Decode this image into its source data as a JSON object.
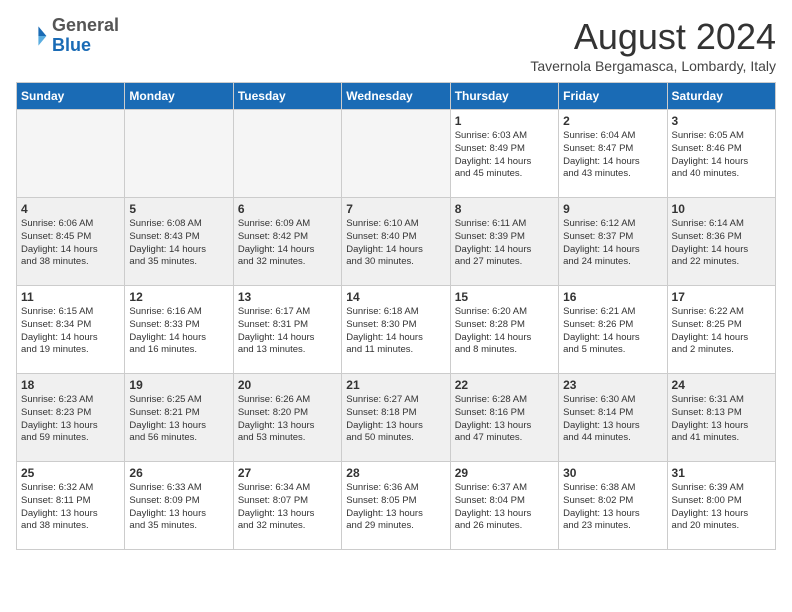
{
  "header": {
    "logo_general": "General",
    "logo_blue": "Blue",
    "month_year": "August 2024",
    "location": "Tavernola Bergamasca, Lombardy, Italy"
  },
  "days_of_week": [
    "Sunday",
    "Monday",
    "Tuesday",
    "Wednesday",
    "Thursday",
    "Friday",
    "Saturday"
  ],
  "weeks": [
    [
      {
        "day": "",
        "info": ""
      },
      {
        "day": "",
        "info": ""
      },
      {
        "day": "",
        "info": ""
      },
      {
        "day": "",
        "info": ""
      },
      {
        "day": "1",
        "info": "Sunrise: 6:03 AM\nSunset: 8:49 PM\nDaylight: 14 hours\nand 45 minutes."
      },
      {
        "day": "2",
        "info": "Sunrise: 6:04 AM\nSunset: 8:47 PM\nDaylight: 14 hours\nand 43 minutes."
      },
      {
        "day": "3",
        "info": "Sunrise: 6:05 AM\nSunset: 8:46 PM\nDaylight: 14 hours\nand 40 minutes."
      }
    ],
    [
      {
        "day": "4",
        "info": "Sunrise: 6:06 AM\nSunset: 8:45 PM\nDaylight: 14 hours\nand 38 minutes."
      },
      {
        "day": "5",
        "info": "Sunrise: 6:08 AM\nSunset: 8:43 PM\nDaylight: 14 hours\nand 35 minutes."
      },
      {
        "day": "6",
        "info": "Sunrise: 6:09 AM\nSunset: 8:42 PM\nDaylight: 14 hours\nand 32 minutes."
      },
      {
        "day": "7",
        "info": "Sunrise: 6:10 AM\nSunset: 8:40 PM\nDaylight: 14 hours\nand 30 minutes."
      },
      {
        "day": "8",
        "info": "Sunrise: 6:11 AM\nSunset: 8:39 PM\nDaylight: 14 hours\nand 27 minutes."
      },
      {
        "day": "9",
        "info": "Sunrise: 6:12 AM\nSunset: 8:37 PM\nDaylight: 14 hours\nand 24 minutes."
      },
      {
        "day": "10",
        "info": "Sunrise: 6:14 AM\nSunset: 8:36 PM\nDaylight: 14 hours\nand 22 minutes."
      }
    ],
    [
      {
        "day": "11",
        "info": "Sunrise: 6:15 AM\nSunset: 8:34 PM\nDaylight: 14 hours\nand 19 minutes."
      },
      {
        "day": "12",
        "info": "Sunrise: 6:16 AM\nSunset: 8:33 PM\nDaylight: 14 hours\nand 16 minutes."
      },
      {
        "day": "13",
        "info": "Sunrise: 6:17 AM\nSunset: 8:31 PM\nDaylight: 14 hours\nand 13 minutes."
      },
      {
        "day": "14",
        "info": "Sunrise: 6:18 AM\nSunset: 8:30 PM\nDaylight: 14 hours\nand 11 minutes."
      },
      {
        "day": "15",
        "info": "Sunrise: 6:20 AM\nSunset: 8:28 PM\nDaylight: 14 hours\nand 8 minutes."
      },
      {
        "day": "16",
        "info": "Sunrise: 6:21 AM\nSunset: 8:26 PM\nDaylight: 14 hours\nand 5 minutes."
      },
      {
        "day": "17",
        "info": "Sunrise: 6:22 AM\nSunset: 8:25 PM\nDaylight: 14 hours\nand 2 minutes."
      }
    ],
    [
      {
        "day": "18",
        "info": "Sunrise: 6:23 AM\nSunset: 8:23 PM\nDaylight: 13 hours\nand 59 minutes."
      },
      {
        "day": "19",
        "info": "Sunrise: 6:25 AM\nSunset: 8:21 PM\nDaylight: 13 hours\nand 56 minutes."
      },
      {
        "day": "20",
        "info": "Sunrise: 6:26 AM\nSunset: 8:20 PM\nDaylight: 13 hours\nand 53 minutes."
      },
      {
        "day": "21",
        "info": "Sunrise: 6:27 AM\nSunset: 8:18 PM\nDaylight: 13 hours\nand 50 minutes."
      },
      {
        "day": "22",
        "info": "Sunrise: 6:28 AM\nSunset: 8:16 PM\nDaylight: 13 hours\nand 47 minutes."
      },
      {
        "day": "23",
        "info": "Sunrise: 6:30 AM\nSunset: 8:14 PM\nDaylight: 13 hours\nand 44 minutes."
      },
      {
        "day": "24",
        "info": "Sunrise: 6:31 AM\nSunset: 8:13 PM\nDaylight: 13 hours\nand 41 minutes."
      }
    ],
    [
      {
        "day": "25",
        "info": "Sunrise: 6:32 AM\nSunset: 8:11 PM\nDaylight: 13 hours\nand 38 minutes."
      },
      {
        "day": "26",
        "info": "Sunrise: 6:33 AM\nSunset: 8:09 PM\nDaylight: 13 hours\nand 35 minutes."
      },
      {
        "day": "27",
        "info": "Sunrise: 6:34 AM\nSunset: 8:07 PM\nDaylight: 13 hours\nand 32 minutes."
      },
      {
        "day": "28",
        "info": "Sunrise: 6:36 AM\nSunset: 8:05 PM\nDaylight: 13 hours\nand 29 minutes."
      },
      {
        "day": "29",
        "info": "Sunrise: 6:37 AM\nSunset: 8:04 PM\nDaylight: 13 hours\nand 26 minutes."
      },
      {
        "day": "30",
        "info": "Sunrise: 6:38 AM\nSunset: 8:02 PM\nDaylight: 13 hours\nand 23 minutes."
      },
      {
        "day": "31",
        "info": "Sunrise: 6:39 AM\nSunset: 8:00 PM\nDaylight: 13 hours\nand 20 minutes."
      }
    ]
  ]
}
